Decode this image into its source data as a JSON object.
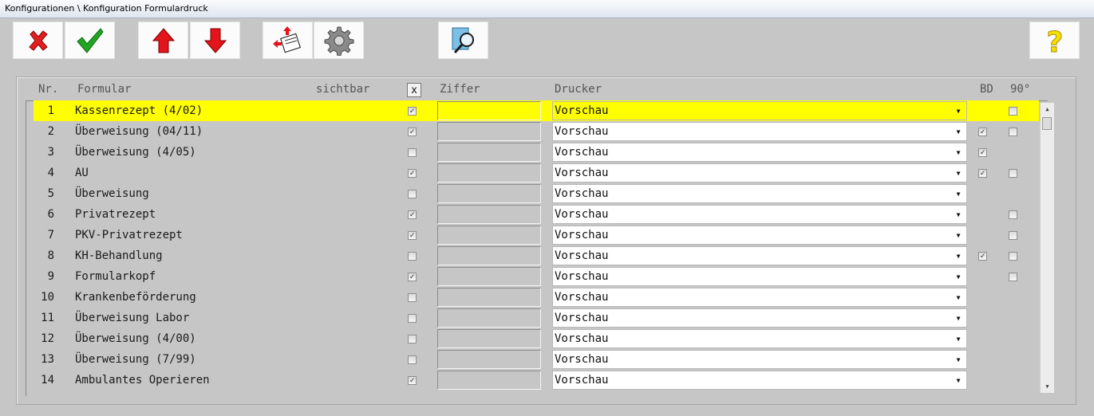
{
  "window": {
    "title": "Konfigurationen \\ Konfiguration Formulardruck"
  },
  "toolbar": {
    "buttons": [
      {
        "name": "cancel-button",
        "icon": "red-x-icon"
      },
      {
        "name": "ok-button",
        "icon": "green-check-icon"
      },
      {
        "name": "move-up-button",
        "icon": "red-up-arrow-icon"
      },
      {
        "name": "move-down-button",
        "icon": "red-down-arrow-icon"
      },
      {
        "name": "printer-swap-button",
        "icon": "form-transfer-icon"
      },
      {
        "name": "settings-button",
        "icon": "gear-icon"
      },
      {
        "name": "preview-button",
        "icon": "magnifier-document-icon"
      },
      {
        "name": "help-button",
        "icon": "help-question-icon"
      }
    ]
  },
  "columns": {
    "nr": "Nr.",
    "formular": "Formular",
    "sichtbar": "sichtbar",
    "toggle": "x",
    "ziffer": "Ziffer",
    "drucker": "Drucker",
    "bd": "BD",
    "rot90": "90°"
  },
  "rows": [
    {
      "nr": "1",
      "name": "Kassenrezept (4/02)",
      "visible": true,
      "ziffer": "",
      "printer": "Vorschau",
      "bd": null,
      "rot": false,
      "selected": true
    },
    {
      "nr": "2",
      "name": "Überweisung (04/11)",
      "visible": true,
      "ziffer": "",
      "printer": "Vorschau",
      "bd": true,
      "rot": false,
      "selected": false
    },
    {
      "nr": "3",
      "name": "Überweisung (4/05)",
      "visible": false,
      "ziffer": "",
      "printer": "Vorschau",
      "bd": true,
      "rot": null,
      "selected": false
    },
    {
      "nr": "4",
      "name": "AU",
      "visible": true,
      "ziffer": "",
      "printer": "Vorschau",
      "bd": true,
      "rot": false,
      "selected": false
    },
    {
      "nr": "5",
      "name": "Überweisung",
      "visible": false,
      "ziffer": "",
      "printer": "Vorschau",
      "bd": null,
      "rot": null,
      "selected": false
    },
    {
      "nr": "6",
      "name": "Privatrezept",
      "visible": true,
      "ziffer": "",
      "printer": "Vorschau",
      "bd": null,
      "rot": false,
      "selected": false
    },
    {
      "nr": "7",
      "name": "PKV-Privatrezept",
      "visible": true,
      "ziffer": "",
      "printer": "Vorschau",
      "bd": null,
      "rot": false,
      "selected": false
    },
    {
      "nr": "8",
      "name": "KH-Behandlung",
      "visible": false,
      "ziffer": "",
      "printer": "Vorschau",
      "bd": true,
      "rot": false,
      "selected": false
    },
    {
      "nr": "9",
      "name": "Formularkopf",
      "visible": true,
      "ziffer": "",
      "printer": "Vorschau",
      "bd": null,
      "rot": false,
      "selected": false
    },
    {
      "nr": "10",
      "name": "Krankenbeförderung",
      "visible": false,
      "ziffer": "",
      "printer": "Vorschau",
      "bd": null,
      "rot": null,
      "selected": false
    },
    {
      "nr": "11",
      "name": "Überweisung Labor",
      "visible": false,
      "ziffer": "",
      "printer": "Vorschau",
      "bd": null,
      "rot": null,
      "selected": false
    },
    {
      "nr": "12",
      "name": "Überweisung (4/00)",
      "visible": false,
      "ziffer": "",
      "printer": "Vorschau",
      "bd": null,
      "rot": null,
      "selected": false
    },
    {
      "nr": "13",
      "name": "Überweisung (7/99)",
      "visible": false,
      "ziffer": "",
      "printer": "Vorschau",
      "bd": null,
      "rot": null,
      "selected": false
    },
    {
      "nr": "14",
      "name": "Ambulantes Operieren",
      "visible": true,
      "ziffer": "",
      "printer": "Vorschau",
      "bd": null,
      "rot": null,
      "selected": false
    }
  ],
  "colors": {
    "selection": "#ffff00",
    "background": "#c6c6c6"
  }
}
